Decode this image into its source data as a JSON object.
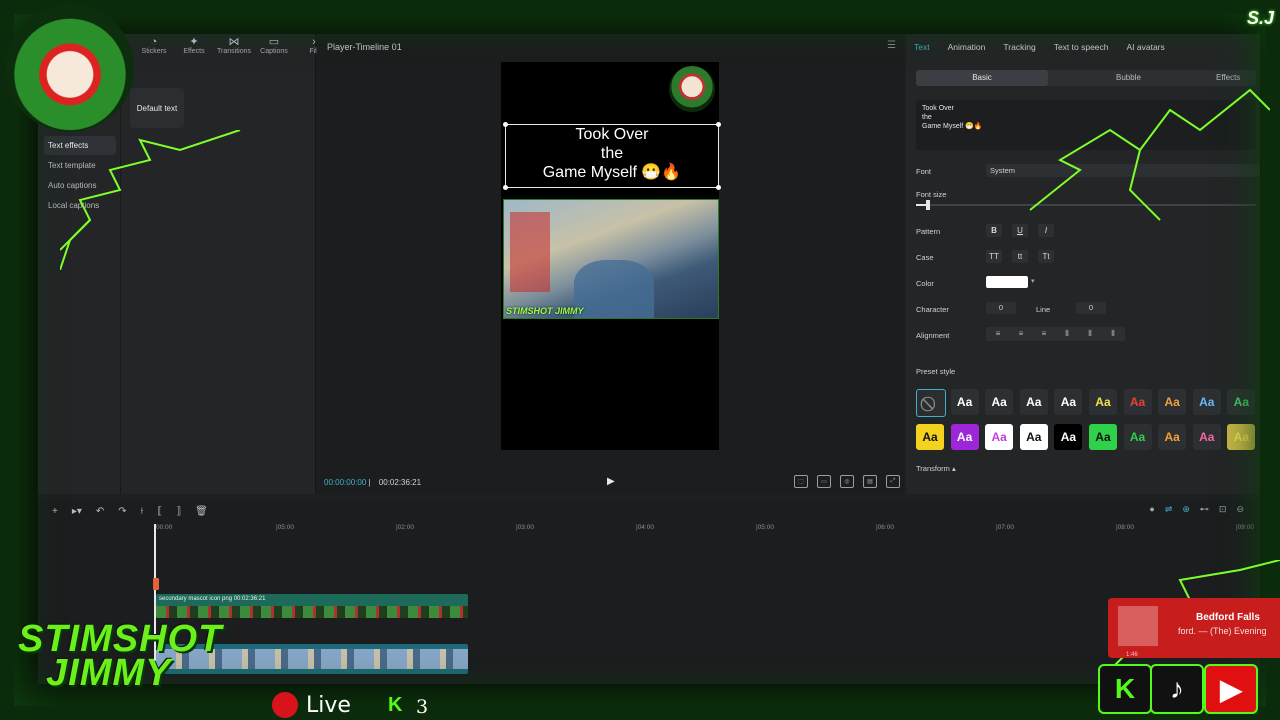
{
  "left_panel": {
    "tool_tabs": [
      {
        "icon": "stickers-icon",
        "label": "Stickers"
      },
      {
        "icon": "effects-icon",
        "label": "Effects"
      },
      {
        "icon": "transitions-icon",
        "label": "Transitions"
      },
      {
        "icon": "captions-icon",
        "label": "Captions"
      },
      {
        "icon": "filters-icon",
        "label": "Filt"
      }
    ],
    "side_nav": [
      "Text effects",
      "Text template",
      "Auto captions",
      "Local captions"
    ],
    "default_text": "Default text"
  },
  "player": {
    "title": "Player-Timeline 01",
    "canvas_text": [
      "Took Over",
      "the",
      "Game Myself 😷🔥"
    ],
    "video_badge": "STIMSHOT JIMMY",
    "time_current": "00:00:00:00",
    "time_total": "00:02:36:21"
  },
  "inspector": {
    "tabs": [
      "Text",
      "Animation",
      "Tracking",
      "Text to speech",
      "AI avatars"
    ],
    "active_tab": "Text",
    "sub_tabs": [
      "Basic",
      "Bubble",
      "Effects"
    ],
    "text_content": [
      "Took Over",
      "the",
      "Game Myself 😷🔥"
    ],
    "font_label": "Font",
    "font_value": "System",
    "font_size_label": "Font size",
    "pattern_label": "Pattern",
    "pattern_buttons": [
      "B",
      "U",
      "I"
    ],
    "case_label": "Case",
    "case_buttons": [
      "TT",
      "tt",
      "Tt"
    ],
    "color_label": "Color",
    "color_value": "#ffffff",
    "character_label": "Character",
    "character_value": "0",
    "line_label": "Line",
    "line_value": "0",
    "alignment_label": "Alignment",
    "preset_label": "Preset style",
    "transform_label": "Transform",
    "preset_styles": [
      {
        "t": "⃠",
        "fg": "#888888",
        "bg": "#2b2e30"
      },
      {
        "t": "Aa",
        "fg": "#ffffff",
        "bg": "#2d3033"
      },
      {
        "t": "Aa",
        "fg": "#ffffff",
        "bg": "#2d3033"
      },
      {
        "t": "Aa",
        "fg": "#ffffff",
        "bg": "#2d3033"
      },
      {
        "t": "Aa",
        "fg": "#ffffff",
        "bg": "#2d3033"
      },
      {
        "t": "Aa",
        "fg": "#f5e24a",
        "bg": "#2d3033"
      },
      {
        "t": "Aa",
        "fg": "#e8403a",
        "bg": "#2d3033"
      },
      {
        "t": "Aa",
        "fg": "#f0a040",
        "bg": "#2d3033"
      },
      {
        "t": "Aa",
        "fg": "#6ab8f5",
        "bg": "#2d3033"
      },
      {
        "t": "Aa",
        "fg": "#3fd06a",
        "bg": "#2d3033"
      },
      {
        "t": "Aa",
        "fg": "#111111",
        "bg": "#f5d21e"
      },
      {
        "t": "Aa",
        "fg": "#ffffff",
        "bg": "#9b27d8"
      },
      {
        "t": "Aa",
        "fg": "#c43ee0",
        "bg": "#ffffff"
      },
      {
        "t": "Aa",
        "fg": "#111111",
        "bg": "#ffffff"
      },
      {
        "t": "Aa",
        "fg": "#ffffff",
        "bg": "#000000"
      },
      {
        "t": "Aa",
        "fg": "#111111",
        "bg": "#2fd04a"
      },
      {
        "t": "Aa",
        "fg": "#2fd04a",
        "bg": "#2d3033"
      },
      {
        "t": "Aa",
        "fg": "#f5a030",
        "bg": "#2d3033"
      },
      {
        "t": "Aa",
        "fg": "#f06aa0",
        "bg": "#2d3033"
      },
      {
        "t": "Aa",
        "fg": "#f5e24a",
        "bg": "#c9b84a"
      }
    ]
  },
  "timeline": {
    "ruler": [
      "00:00",
      "|05:00",
      "|02:00",
      "|03:00",
      "|04:00",
      "|05:00",
      "|06:00",
      "|07:00",
      "|08:00",
      "|09:00"
    ],
    "track1_label": "secondary mascot icon png  00:02:36:21"
  },
  "overlay": {
    "brand_line1": "STIMSHOT",
    "brand_line2": "JIMMY",
    "live_text": "Live",
    "k_badge": "K",
    "viewer_count": "3",
    "music_title": "Bedford Falls",
    "music_artist": "ford. — (The) Evening",
    "music_time": "1:46",
    "corner_logo": "S.J"
  }
}
